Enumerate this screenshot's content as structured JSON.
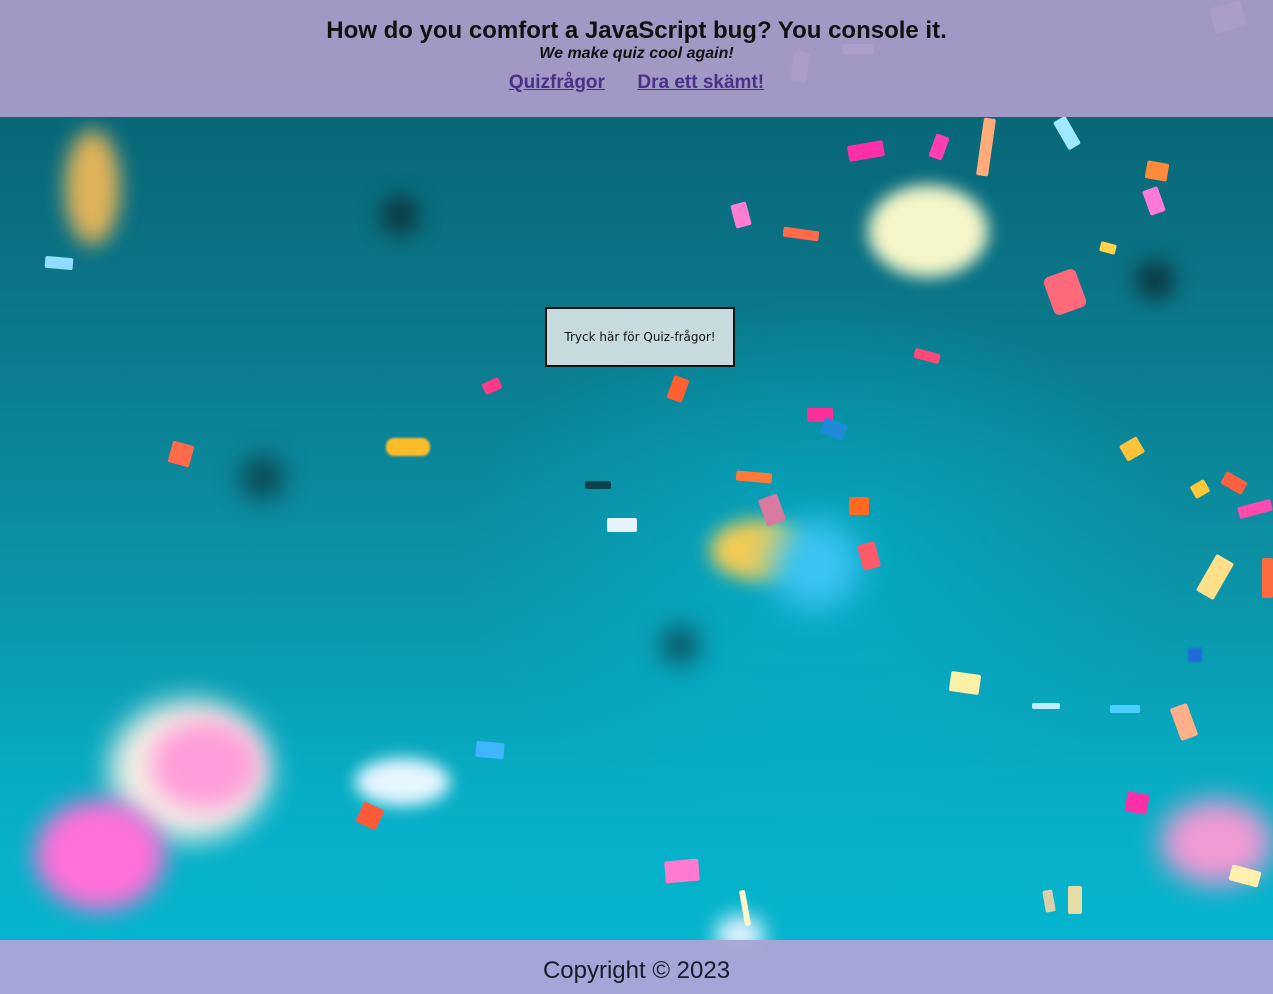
{
  "header": {
    "title": "How do you comfort a JavaScript bug? You console it.",
    "subtitle": "We make quiz cool again!",
    "nav": [
      {
        "label": "Quizfrågor"
      },
      {
        "label": "Dra ett skämt!"
      }
    ]
  },
  "main": {
    "quiz_button_label": "Tryck här för Quiz-frågor!"
  },
  "footer": {
    "copyright": "Copyright © 2023"
  },
  "colors": {
    "header_bg": "#a89bc8",
    "footer_bg": "#a8a5d6",
    "link": "#4a2f86",
    "button_bg": "#c7dbdf"
  }
}
